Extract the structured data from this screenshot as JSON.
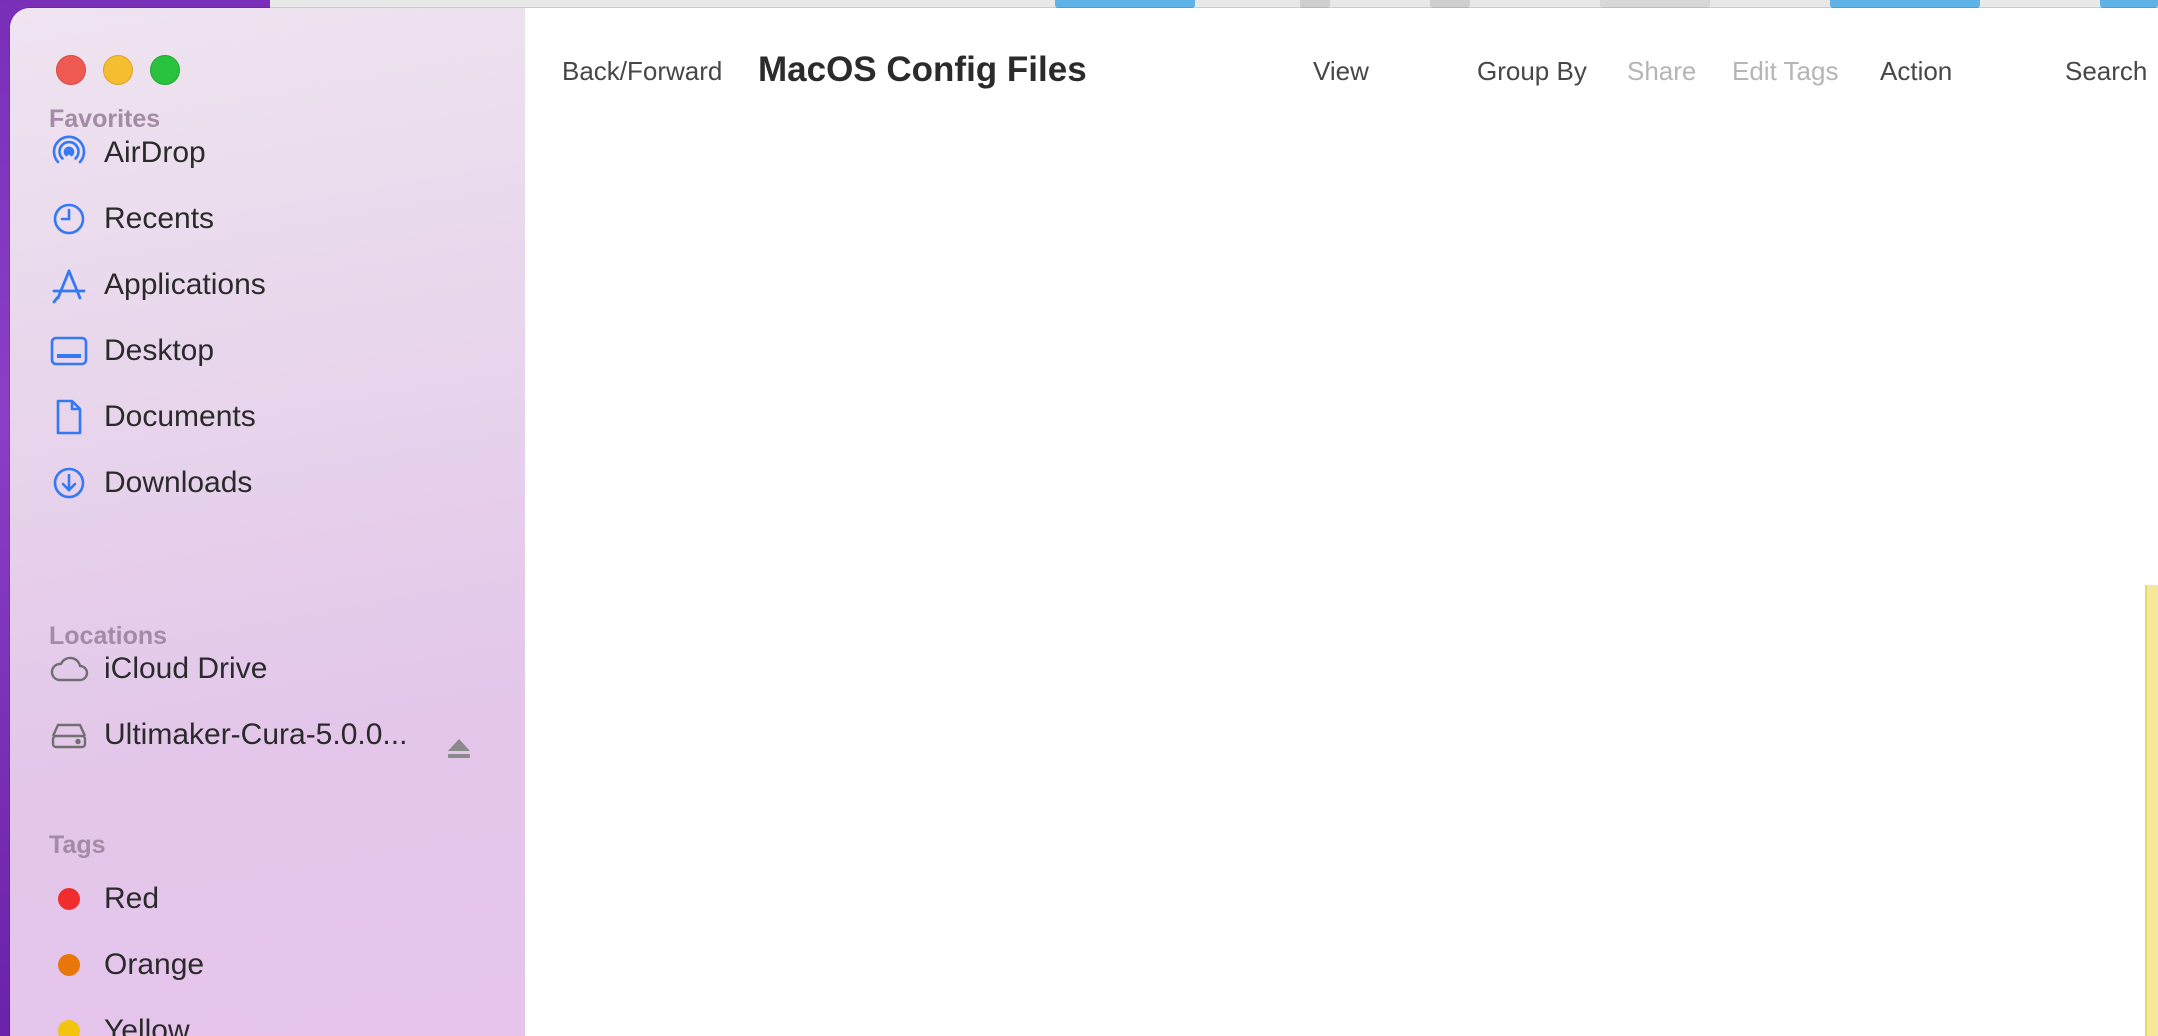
{
  "window": {
    "title": "MacOS Config Files"
  },
  "toolbar": {
    "back_forward": "Back/Forward",
    "view": "View",
    "group_by": "Group By",
    "share": "Share",
    "edit_tags": "Edit Tags",
    "action": "Action",
    "search": "Search"
  },
  "sidebar": {
    "favorites_title": "Favorites",
    "favorites": [
      {
        "label": "AirDrop",
        "icon": "airdrop-icon"
      },
      {
        "label": "Recents",
        "icon": "clock-icon"
      },
      {
        "label": "Applications",
        "icon": "applications-icon"
      },
      {
        "label": "Desktop",
        "icon": "desktop-icon"
      },
      {
        "label": "Documents",
        "icon": "document-icon"
      },
      {
        "label": "Downloads",
        "icon": "download-icon"
      }
    ],
    "locations_title": "Locations",
    "locations": [
      {
        "label": "iCloud Drive",
        "icon": "cloud-icon"
      },
      {
        "label": "Ultimaker-Cura-5.0.0...",
        "icon": "disk-icon"
      }
    ],
    "tags_title": "Tags",
    "tags": [
      {
        "label": "Red",
        "color": "#f02d2d"
      },
      {
        "label": "Orange",
        "color": "#e8760a"
      },
      {
        "label": "Yellow",
        "color": "#f2c30f"
      }
    ]
  },
  "colors": {
    "accent_icon": "#3478f6",
    "traffic_red": "#ee5a52",
    "traffic_yellow": "#f5bd30",
    "traffic_green": "#29c23f"
  }
}
